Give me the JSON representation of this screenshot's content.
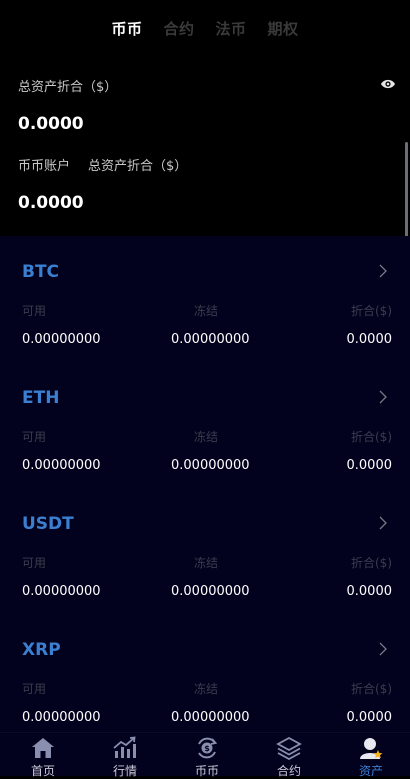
{
  "tabs": [
    {
      "label": "币币",
      "active": true
    },
    {
      "label": "合约",
      "active": false
    },
    {
      "label": "法币",
      "active": false
    },
    {
      "label": "期权",
      "active": false
    }
  ],
  "summary": {
    "total_label": "总资产折合（$）",
    "total_value": "0.0000",
    "account_label": "币币账户",
    "account_total_label": "总资产折合（$）",
    "account_value": "0.0000"
  },
  "column_labels": {
    "available": "可用",
    "frozen": "冻结",
    "converted": "折合($)"
  },
  "coins": [
    {
      "symbol": "BTC",
      "available": "0.00000000",
      "frozen": "0.00000000",
      "converted": "0.0000"
    },
    {
      "symbol": "ETH",
      "available": "0.00000000",
      "frozen": "0.00000000",
      "converted": "0.0000"
    },
    {
      "symbol": "USDT",
      "available": "0.00000000",
      "frozen": "0.00000000",
      "converted": "0.0000"
    },
    {
      "symbol": "XRP",
      "available": "0.00000000",
      "frozen": "0.00000000",
      "converted": "0.0000"
    }
  ],
  "bottom_nav": [
    {
      "label": "首页",
      "icon": "home-icon",
      "active": false
    },
    {
      "label": "行情",
      "icon": "market-chart-icon",
      "active": false
    },
    {
      "label": "币币",
      "icon": "coin-exchange-icon",
      "active": false
    },
    {
      "label": "合约",
      "icon": "layers-icon",
      "active": false
    },
    {
      "label": "资产",
      "icon": "user-star-icon",
      "active": true
    }
  ],
  "colors": {
    "background": "#000000",
    "list_background": "#02021e",
    "accent": "#3b7fd1"
  }
}
